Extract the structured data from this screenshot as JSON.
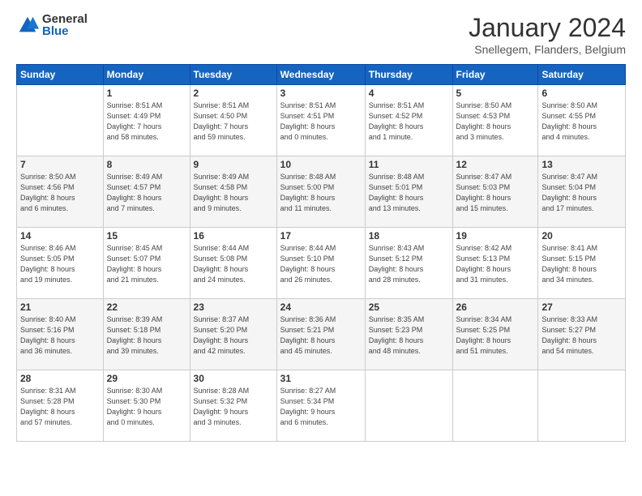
{
  "logo": {
    "general": "General",
    "blue": "Blue"
  },
  "header": {
    "title": "January 2024",
    "subtitle": "Snellegem, Flanders, Belgium"
  },
  "weekdays": [
    "Sunday",
    "Monday",
    "Tuesday",
    "Wednesday",
    "Thursday",
    "Friday",
    "Saturday"
  ],
  "weeks": [
    [
      {
        "num": "",
        "info": ""
      },
      {
        "num": "1",
        "info": "Sunrise: 8:51 AM\nSunset: 4:49 PM\nDaylight: 7 hours\nand 58 minutes."
      },
      {
        "num": "2",
        "info": "Sunrise: 8:51 AM\nSunset: 4:50 PM\nDaylight: 7 hours\nand 59 minutes."
      },
      {
        "num": "3",
        "info": "Sunrise: 8:51 AM\nSunset: 4:51 PM\nDaylight: 8 hours\nand 0 minutes."
      },
      {
        "num": "4",
        "info": "Sunrise: 8:51 AM\nSunset: 4:52 PM\nDaylight: 8 hours\nand 1 minute."
      },
      {
        "num": "5",
        "info": "Sunrise: 8:50 AM\nSunset: 4:53 PM\nDaylight: 8 hours\nand 3 minutes."
      },
      {
        "num": "6",
        "info": "Sunrise: 8:50 AM\nSunset: 4:55 PM\nDaylight: 8 hours\nand 4 minutes."
      }
    ],
    [
      {
        "num": "7",
        "info": "Sunrise: 8:50 AM\nSunset: 4:56 PM\nDaylight: 8 hours\nand 6 minutes."
      },
      {
        "num": "8",
        "info": "Sunrise: 8:49 AM\nSunset: 4:57 PM\nDaylight: 8 hours\nand 7 minutes."
      },
      {
        "num": "9",
        "info": "Sunrise: 8:49 AM\nSunset: 4:58 PM\nDaylight: 8 hours\nand 9 minutes."
      },
      {
        "num": "10",
        "info": "Sunrise: 8:48 AM\nSunset: 5:00 PM\nDaylight: 8 hours\nand 11 minutes."
      },
      {
        "num": "11",
        "info": "Sunrise: 8:48 AM\nSunset: 5:01 PM\nDaylight: 8 hours\nand 13 minutes."
      },
      {
        "num": "12",
        "info": "Sunrise: 8:47 AM\nSunset: 5:03 PM\nDaylight: 8 hours\nand 15 minutes."
      },
      {
        "num": "13",
        "info": "Sunrise: 8:47 AM\nSunset: 5:04 PM\nDaylight: 8 hours\nand 17 minutes."
      }
    ],
    [
      {
        "num": "14",
        "info": "Sunrise: 8:46 AM\nSunset: 5:05 PM\nDaylight: 8 hours\nand 19 minutes."
      },
      {
        "num": "15",
        "info": "Sunrise: 8:45 AM\nSunset: 5:07 PM\nDaylight: 8 hours\nand 21 minutes."
      },
      {
        "num": "16",
        "info": "Sunrise: 8:44 AM\nSunset: 5:08 PM\nDaylight: 8 hours\nand 24 minutes."
      },
      {
        "num": "17",
        "info": "Sunrise: 8:44 AM\nSunset: 5:10 PM\nDaylight: 8 hours\nand 26 minutes."
      },
      {
        "num": "18",
        "info": "Sunrise: 8:43 AM\nSunset: 5:12 PM\nDaylight: 8 hours\nand 28 minutes."
      },
      {
        "num": "19",
        "info": "Sunrise: 8:42 AM\nSunset: 5:13 PM\nDaylight: 8 hours\nand 31 minutes."
      },
      {
        "num": "20",
        "info": "Sunrise: 8:41 AM\nSunset: 5:15 PM\nDaylight: 8 hours\nand 34 minutes."
      }
    ],
    [
      {
        "num": "21",
        "info": "Sunrise: 8:40 AM\nSunset: 5:16 PM\nDaylight: 8 hours\nand 36 minutes."
      },
      {
        "num": "22",
        "info": "Sunrise: 8:39 AM\nSunset: 5:18 PM\nDaylight: 8 hours\nand 39 minutes."
      },
      {
        "num": "23",
        "info": "Sunrise: 8:37 AM\nSunset: 5:20 PM\nDaylight: 8 hours\nand 42 minutes."
      },
      {
        "num": "24",
        "info": "Sunrise: 8:36 AM\nSunset: 5:21 PM\nDaylight: 8 hours\nand 45 minutes."
      },
      {
        "num": "25",
        "info": "Sunrise: 8:35 AM\nSunset: 5:23 PM\nDaylight: 8 hours\nand 48 minutes."
      },
      {
        "num": "26",
        "info": "Sunrise: 8:34 AM\nSunset: 5:25 PM\nDaylight: 8 hours\nand 51 minutes."
      },
      {
        "num": "27",
        "info": "Sunrise: 8:33 AM\nSunset: 5:27 PM\nDaylight: 8 hours\nand 54 minutes."
      }
    ],
    [
      {
        "num": "28",
        "info": "Sunrise: 8:31 AM\nSunset: 5:28 PM\nDaylight: 8 hours\nand 57 minutes."
      },
      {
        "num": "29",
        "info": "Sunrise: 8:30 AM\nSunset: 5:30 PM\nDaylight: 9 hours\nand 0 minutes."
      },
      {
        "num": "30",
        "info": "Sunrise: 8:28 AM\nSunset: 5:32 PM\nDaylight: 9 hours\nand 3 minutes."
      },
      {
        "num": "31",
        "info": "Sunrise: 8:27 AM\nSunset: 5:34 PM\nDaylight: 9 hours\nand 6 minutes."
      },
      {
        "num": "",
        "info": ""
      },
      {
        "num": "",
        "info": ""
      },
      {
        "num": "",
        "info": ""
      }
    ]
  ]
}
